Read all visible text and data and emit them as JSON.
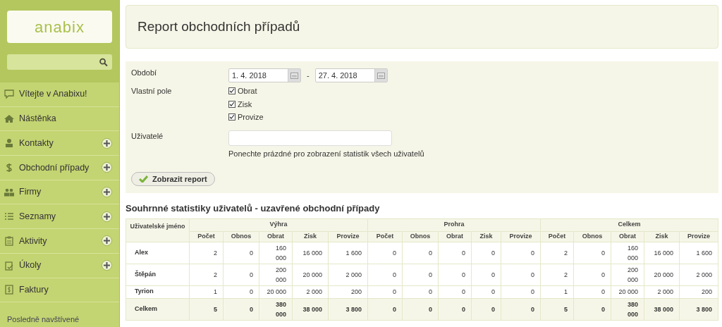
{
  "sidebar": {
    "logo": "anabix",
    "items": [
      {
        "label": "Vítejte v Anabixu!",
        "plus": false
      },
      {
        "label": "Nástěnka",
        "plus": false
      },
      {
        "label": "Kontakty",
        "plus": true
      },
      {
        "label": "Obchodní případy",
        "plus": true
      },
      {
        "label": "Firmy",
        "plus": true
      },
      {
        "label": "Seznamy",
        "plus": true
      },
      {
        "label": "Aktivity",
        "plus": true
      },
      {
        "label": "Úkoly",
        "plus": true
      },
      {
        "label": "Faktury",
        "plus": false
      }
    ],
    "section": "Posledně navštívené"
  },
  "page_title": "Report obchodních případů",
  "form": {
    "period_label": "Období",
    "date_from": "1. 4. 2018",
    "separator": "-",
    "date_to": "27. 4. 2018",
    "fields_label": "Vlastní pole",
    "fields": [
      {
        "label": "Obrat",
        "checked": true
      },
      {
        "label": "Zisk",
        "checked": true
      },
      {
        "label": "Provize",
        "checked": true
      }
    ],
    "users_label": "Uživatelé",
    "users_hint": "Ponechte prázdné pro zobrazení statistik všech uživatelů",
    "submit": "Zobrazit report"
  },
  "table": {
    "title": "Souhrnné statistiky uživatelů - uzavřené obchodní případy",
    "name_header": "Uživatelské jméno",
    "groups": [
      {
        "label": "Výhra",
        "columns": [
          "Počet",
          "Obnos",
          "Obrat",
          "Zisk",
          "Provize"
        ]
      },
      {
        "label": "Prohra",
        "columns": [
          "Počet",
          "Obnos",
          "Obrat",
          "Zisk",
          "Provize"
        ]
      },
      {
        "label": "Celkem",
        "columns": [
          "Počet",
          "Obnos",
          "Obrat",
          "Zisk",
          "Provize"
        ]
      }
    ],
    "rows": [
      {
        "name": "Alex",
        "total": false,
        "cells": [
          "2",
          "0",
          "160 000",
          "16 000",
          "1 600",
          "0",
          "0",
          "0",
          "0",
          "0",
          "2",
          "0",
          "160 000",
          "16 000",
          "1 600"
        ]
      },
      {
        "name": "Štěpán",
        "total": false,
        "cells": [
          "2",
          "0",
          "200 000",
          "20 000",
          "2 000",
          "0",
          "0",
          "0",
          "0",
          "0",
          "2",
          "0",
          "200 000",
          "20 000",
          "2 000"
        ]
      },
      {
        "name": "Tyrion",
        "total": false,
        "cells": [
          "1",
          "0",
          "20 000",
          "2 000",
          "200",
          "0",
          "0",
          "0",
          "0",
          "0",
          "1",
          "0",
          "20 000",
          "2 000",
          "200"
        ]
      },
      {
        "name": "Celkem",
        "total": true,
        "cells": [
          "5",
          "0",
          "380 000",
          "38 000",
          "3 800",
          "0",
          "0",
          "0",
          "0",
          "0",
          "5",
          "0",
          "380 000",
          "38 000",
          "3 800"
        ]
      }
    ]
  }
}
